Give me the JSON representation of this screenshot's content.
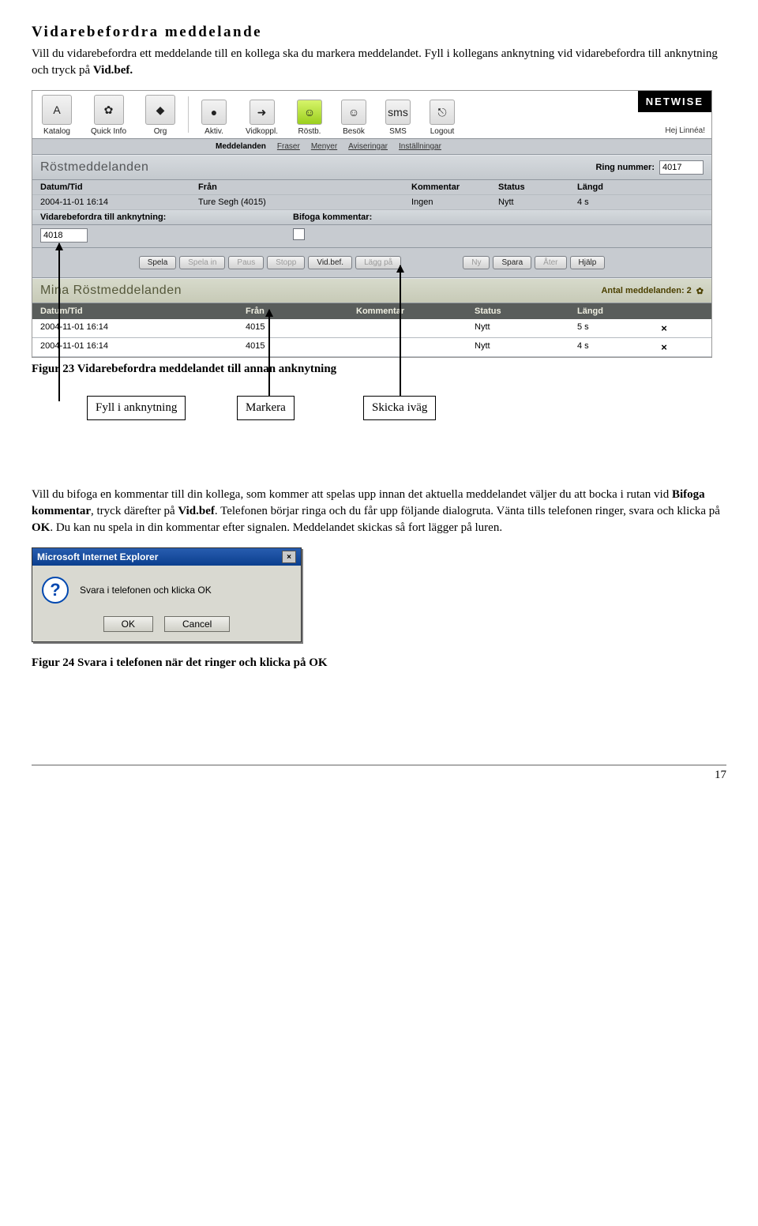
{
  "heading": "Vidarebefordra meddelande",
  "intro_a": "Vill du vidarebefordra ett meddelande till en kollega ska du markera meddelandet. Fyll i kollegans anknytning vid vidarebefordra till anknytning och tryck på ",
  "intro_b": "Vid.bef.",
  "intro_c": "",
  "brand": "NETWISE",
  "greet": "Hej Linnéa!",
  "nav": {
    "katalog": "Katalog",
    "quick": "Quick Info",
    "org": "Org",
    "aktiv": "Aktiv.",
    "vidkoppl": "Vidkoppl.",
    "rostb": "Röstb.",
    "besok": "Besök",
    "sms": "SMS",
    "logout": "Logout"
  },
  "subnav": {
    "meddelanden": "Meddelanden",
    "fraser": "Fraser",
    "menyer": "Menyer",
    "aviseringar": "Aviseringar",
    "installningar": "Inställningar"
  },
  "section1": {
    "title": "Röstmeddelanden",
    "ring_label": "Ring nummer:",
    "ring_value": "4017",
    "cols": {
      "dt": "Datum/Tid",
      "from": "Från",
      "kom": "Kommentar",
      "st": "Status",
      "len": "Längd"
    },
    "row": {
      "dt": "2004-11-01 16:14",
      "from": "Ture Segh (4015)",
      "kom": "Ingen",
      "st": "Nytt",
      "len": "4 s"
    },
    "fwd_a": "Vidarebefordra till anknytning:",
    "fwd_b": "Bifoga kommentar:",
    "ext_value": "4018"
  },
  "btns": {
    "spela": "Spela",
    "spelain": "Spela in",
    "paus": "Paus",
    "stopp": "Stopp",
    "vidbef": "Vid.bef.",
    "laggpa": "Lägg på",
    "ny": "Ny",
    "spara": "Spara",
    "ater": "Åter",
    "hjalp": "Hjälp"
  },
  "section2": {
    "title": "Mina Röstmeddelanden",
    "count_label": "Antal meddelanden: 2",
    "rows": [
      {
        "dt": "2004-11-01 16:14",
        "from": "4015",
        "kom": "",
        "st": "Nytt",
        "len": "5 s"
      },
      {
        "dt": "2004-11-01 16:14",
        "from": "4015",
        "kom": "",
        "st": "Nytt",
        "len": "4 s"
      }
    ]
  },
  "callouts": {
    "a": "Fyll i anknytning",
    "b": "Markera",
    "c": "Skicka iväg"
  },
  "fig23": "Figur 23  Vidarebefordra meddelandet till annan anknytning",
  "para2_a": "Vill du bifoga en kommentar till din kollega, som kommer att spelas upp innan det aktuella meddelandet väljer du att bocka i rutan vid ",
  "para2_b": "Bifoga kommentar",
  "para2_c": ", tryck därefter på ",
  "para2_d": "Vid.bef",
  "para2_e": ". Telefonen börjar ringa och du får upp följande dialogruta. Vänta tills telefonen ringer, svara och klicka på ",
  "para2_f": "OK",
  "para2_g": ". Du kan nu spela in din kommentar efter signalen. Meddelandet skickas så fort lägger på luren.",
  "ie": {
    "title": "Microsoft Internet Explorer",
    "msg": "Svara i telefonen och klicka OK",
    "ok": "OK",
    "cancel": "Cancel"
  },
  "fig24": "Figur 24  Svara i telefonen när det ringer och klicka på OK",
  "page": "17"
}
